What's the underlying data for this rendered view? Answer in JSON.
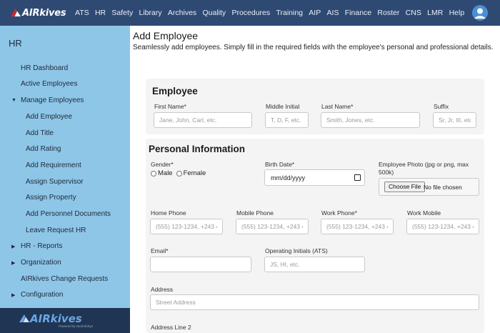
{
  "brand": {
    "name": "AIRkives",
    "footer_name": "AIRkives",
    "footer_sub": "Powered by NexInfoSys"
  },
  "nav": [
    "ATS",
    "HR",
    "Safety",
    "Library",
    "Archives",
    "Quality",
    "Procedures",
    "Training",
    "AIP",
    "AIS",
    "Finance",
    "Roster",
    "CNS",
    "LMR",
    "Help"
  ],
  "sidebar": {
    "title": "HR",
    "items": [
      "HR Dashboard",
      "Active Employees",
      "Manage Employees",
      "Add Employee",
      "Add Title",
      "Add Rating",
      "Add Requirement",
      "Assign Supervisor",
      "Assign Property",
      "Add Personnel Documents",
      "Leave Request HR",
      "HR - Reports",
      "Organization",
      "AIRkives Change Requests",
      "Configuration"
    ],
    "caret_expanded": "▼",
    "caret_collapsed": "▶"
  },
  "page": {
    "title": "Add Employee",
    "subtitle": "Seamlessly add employees. Simply fill in the required fields with the employee's personal and professional details."
  },
  "employee": {
    "title": "Employee",
    "first_name": {
      "label": "First Name*",
      "placeholder": "Jane, John, Carl, etc."
    },
    "middle_initial": {
      "label": "Middle Initial",
      "placeholder": "T, D, F, etc."
    },
    "last_name": {
      "label": "Last Name*",
      "placeholder": "Smith, Jones, etc."
    },
    "suffix": {
      "label": "Suffix",
      "placeholder": "Sr, Jr, III, etc."
    }
  },
  "personal": {
    "title": "Personal Information",
    "gender": {
      "label": "Gender*",
      "options": [
        "Male",
        "Female"
      ]
    },
    "birth_date": {
      "label": "Birth Date*",
      "value": "mm/dd/yyyy"
    },
    "photo": {
      "label_line1": "Employee Photo (jpg or png, max",
      "label_line2": "500k)",
      "button": "Choose File",
      "status": "No file chosen"
    },
    "home_phone": {
      "label": "Home Phone",
      "placeholder": "(555) 123-1234, +243 4"
    },
    "mobile_phone": {
      "label": "Mobile Phone",
      "placeholder": "(555) 123-1234, +243 4"
    },
    "work_phone": {
      "label": "Work Phone*",
      "placeholder": "(555) 123-1234, +243 4"
    },
    "work_mobile": {
      "label": "Work Mobile",
      "placeholder": "(555) 123-1234, +243 4"
    },
    "email": {
      "label": "Email*",
      "placeholder": ""
    },
    "operating_initials": {
      "label": "Operating Initials (ATS)",
      "placeholder": "JS, HI, etc."
    },
    "address": {
      "label": "Address",
      "placeholder": "Street Address"
    },
    "address2": {
      "label": "Address Line 2"
    }
  },
  "colors": {
    "topnav": "#2f4a72",
    "sidebar": "#8ec6e8",
    "sidebar_footer": "#1f3553",
    "card": "#f4f4f4",
    "avatar": "#4a8fd6"
  }
}
